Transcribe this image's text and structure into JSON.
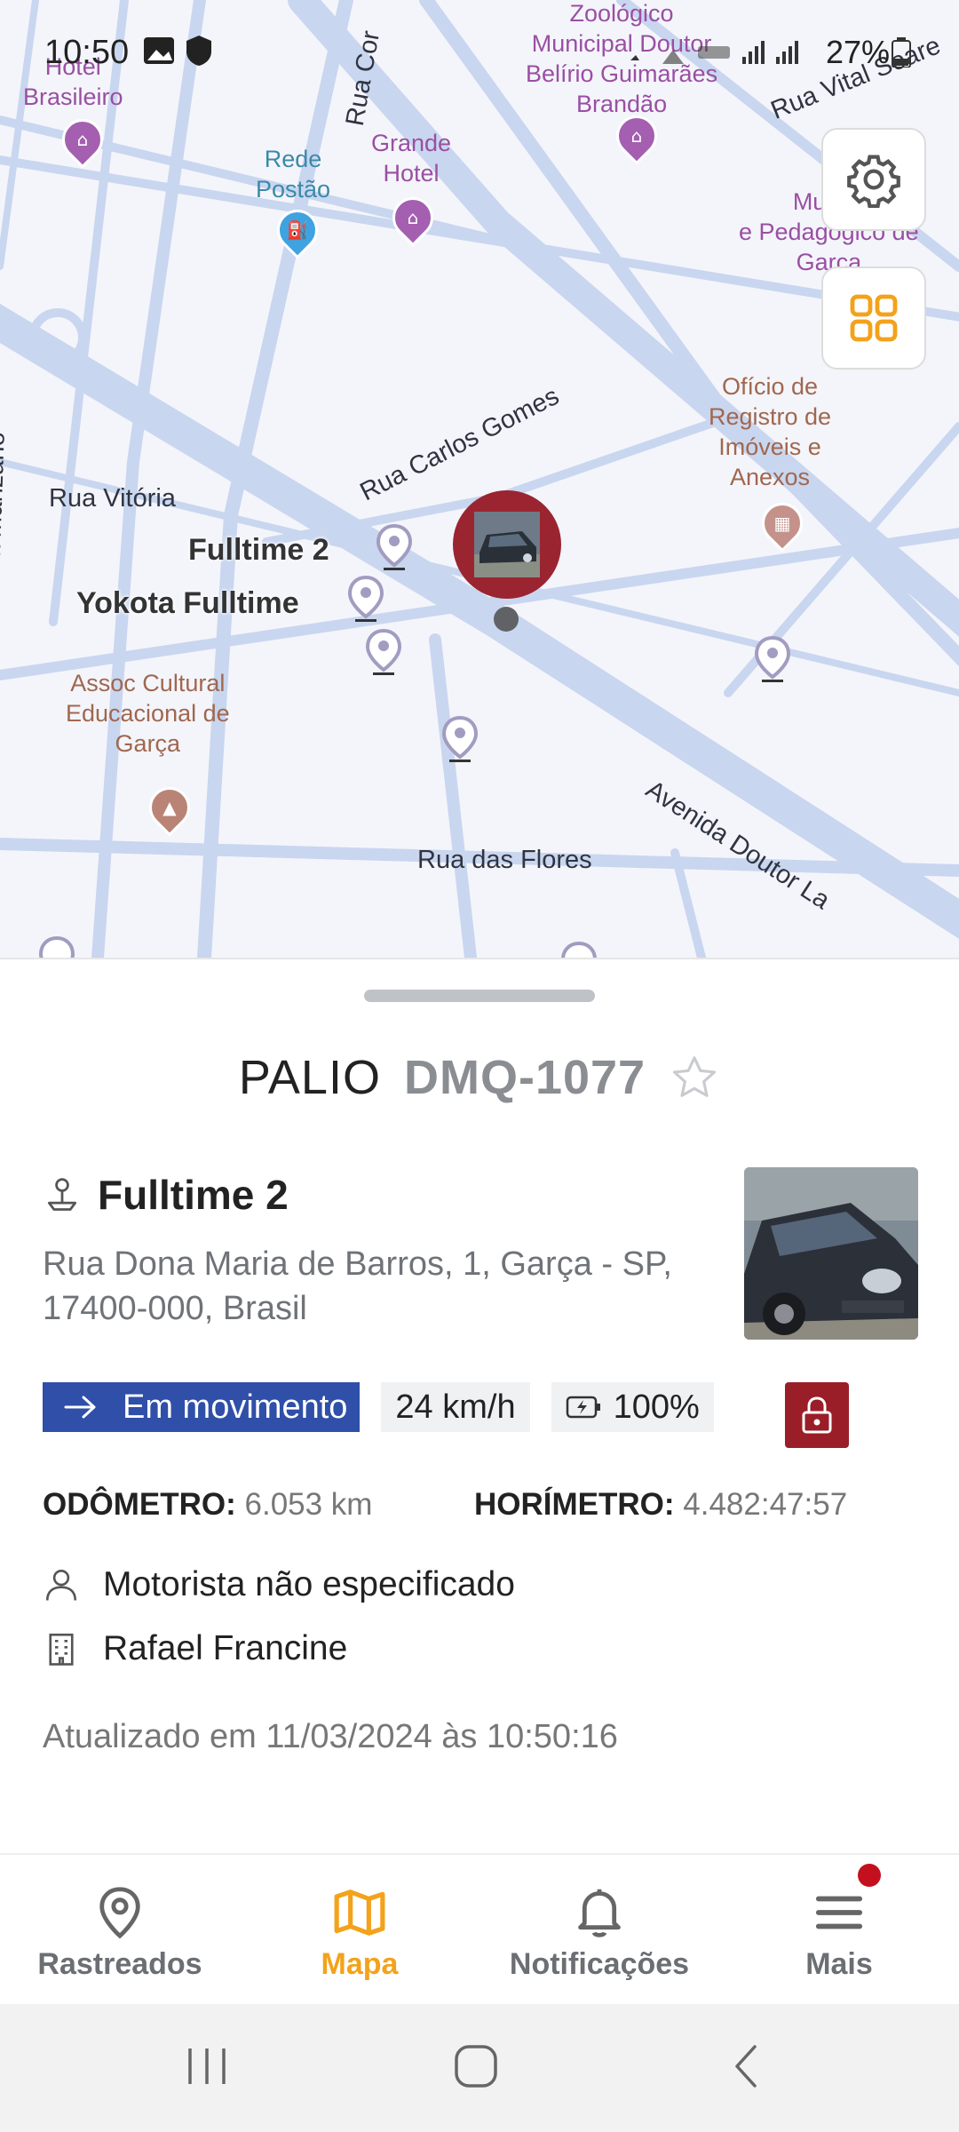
{
  "status_bar": {
    "time": "10:50",
    "battery": "27%"
  },
  "map": {
    "streets": [
      "Rua Carlos Gomes",
      "Rua Vitória",
      "Rua das Flores",
      "Avenida Doutor La",
      "Rua Vital Soare",
      "Rua Cor",
      "Rua Manzano"
    ],
    "pois": [
      {
        "label": "Hotel\nBrasileiro",
        "icon": "hotel-icon"
      },
      {
        "label": "Rede\nPostão",
        "icon": "fuel-icon"
      },
      {
        "label": "Grande\nHotel",
        "icon": "hotel-icon"
      },
      {
        "label": "Zoológico\nMunicipal Doutor\nBelírio Guimarães\nBrandão",
        "icon": "museum-icon"
      },
      {
        "label": "Museu\ne Pedagógico de\nGarça",
        "icon": "museum-icon"
      },
      {
        "label": "Ofício de\nRegistro de\nImóveis e\nAnexos",
        "icon": "building-icon"
      },
      {
        "label": "Assoc Cultural\nEducacional de\nGarça",
        "icon": "school-icon"
      }
    ],
    "vehicle_labels": [
      "Fulltime 2",
      "Yokota Fulltime"
    ],
    "controls": {
      "settings_icon": "gear-icon",
      "layers_icon": "grid-icon"
    }
  },
  "sheet": {
    "vehicle_name": "PALIO",
    "plate": "DMQ-1077",
    "location_title": "Fulltime 2",
    "address": "Rua Dona Maria de Barros, 1, Garça - SP, 17400-000, Brasil",
    "status": "Em movimento",
    "speed": "24 km/h",
    "battery": "100%",
    "odometer_label": "ODÔMETRO:",
    "odometer_value": "6.053 km",
    "hourmeter_label": "HORÍMETRO:",
    "hourmeter_value": "4.482:47:57",
    "driver": "Motorista não especificado",
    "company": "Rafael Francine",
    "updated": "Atualizado em 11/03/2024 às 10:50:16"
  },
  "nav": {
    "items": [
      {
        "label": "Rastreados",
        "icon": "location-pin-icon"
      },
      {
        "label": "Mapa",
        "icon": "map-icon"
      },
      {
        "label": "Notificações",
        "icon": "bell-icon"
      },
      {
        "label": "Mais",
        "icon": "menu-icon"
      }
    ],
    "active": "Mapa"
  },
  "colors": {
    "accent": "#f3a21b",
    "status_blue": "#2f4fa8",
    "lock_red": "#9a1e28",
    "road": "#c9d6ef",
    "map_bg": "#f4f5fb"
  }
}
